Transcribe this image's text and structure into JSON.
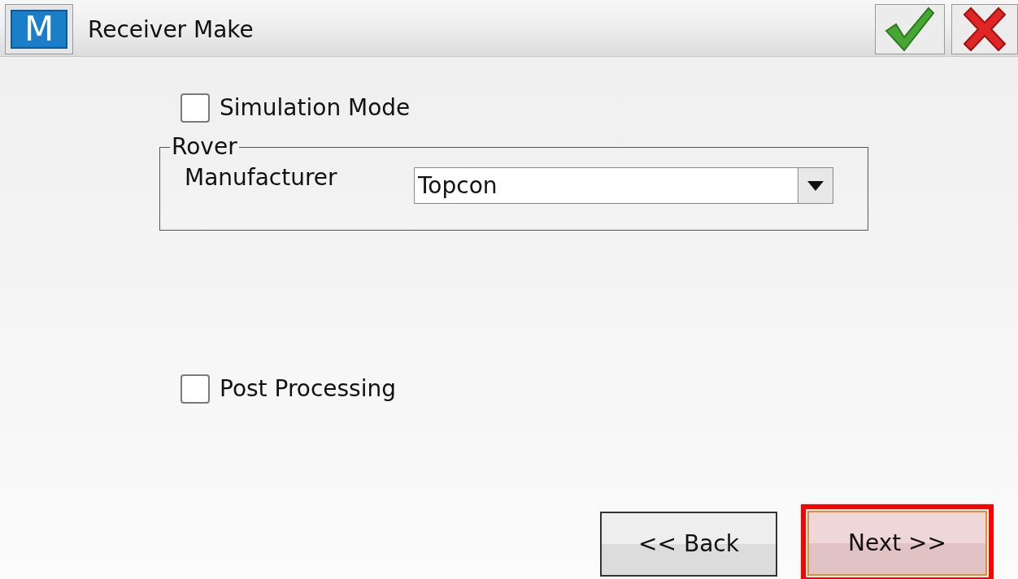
{
  "window": {
    "logo": "M",
    "title": "Receiver Make"
  },
  "options": [
    {
      "label": "Simulation Mode",
      "checked": false
    }
  ],
  "rover": {
    "legend": "Rover",
    "manufacturer_label": "Manufacturer",
    "manufacturer_value": "Topcon"
  },
  "post_processing": {
    "label": "Post Processing",
    "checked": false
  },
  "buttons": [
    {
      "label": "<< Back",
      "highlighted": false
    },
    {
      "label": "Next >>",
      "highlighted": true
    }
  ]
}
